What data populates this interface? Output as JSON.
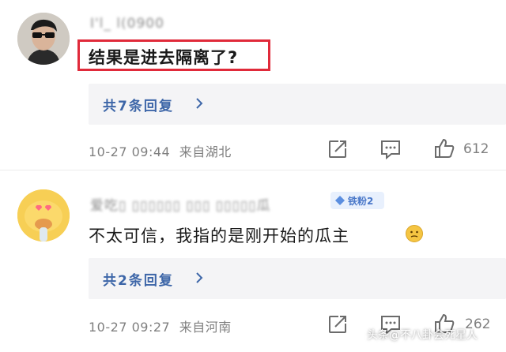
{
  "comment1": {
    "username": "I'l_ l(0900",
    "text": "结果是进去隔离了?",
    "highlight_color": "#e02a3a",
    "replies_label": "共7条回复",
    "date": "10-27 09:44",
    "location": "来自湖北",
    "like_count": "612"
  },
  "comment2": {
    "username": "爱吃▯ ▯▯▯▯▯▯ ▯▯▯ ▯▯▯▯▯瓜",
    "badge": "铁粉2",
    "text": "不太可信，我指的是刚开始的瓜主",
    "replies_label": "共2条回复",
    "date": "10-27 09:27",
    "location": "来自河南",
    "like_count": "262"
  },
  "watermark": {
    "text": "头条@不八卦会死星人"
  }
}
